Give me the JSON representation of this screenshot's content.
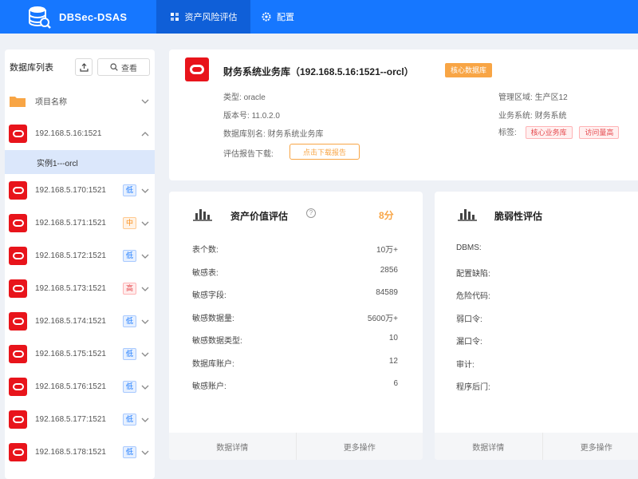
{
  "app": {
    "brand": "DBSec-DSAS"
  },
  "nav": {
    "tabs": [
      {
        "label": "资产风险评估"
      },
      {
        "label": "配置"
      }
    ]
  },
  "sidebar": {
    "title": "数据库列表",
    "search_label": "查看",
    "group": {
      "label": "项目名称"
    },
    "expanded": {
      "label": "192.168.5.16:1521",
      "instance": "实例1---orcl"
    },
    "items": [
      {
        "label": "192.168.5.170:1521",
        "risk": "低",
        "level": "low"
      },
      {
        "label": "192.168.5.171:1521",
        "risk": "中",
        "level": "mid"
      },
      {
        "label": "192.168.5.172:1521",
        "risk": "低",
        "level": "low"
      },
      {
        "label": "192.168.5.173:1521",
        "risk": "高",
        "level": "high"
      },
      {
        "label": "192.168.5.174:1521",
        "risk": "低",
        "level": "low"
      },
      {
        "label": "192.168.5.175:1521",
        "risk": "低",
        "level": "low"
      },
      {
        "label": "192.168.5.176:1521",
        "risk": "低",
        "level": "low"
      },
      {
        "label": "192.168.5.177:1521",
        "risk": "低",
        "level": "low"
      },
      {
        "label": "192.168.5.178:1521",
        "risk": "低",
        "level": "low"
      }
    ]
  },
  "header": {
    "title": "财务系统业务库（192.168.5.16:1521--orcl）",
    "core_tag": "核心数据库",
    "type_label": "类型:",
    "type_value": "oracle",
    "version_label": "版本号:",
    "version_value": "11.0.2.0",
    "alias_label": "数据库别名:",
    "alias_value": "财务系统业务库",
    "report_label": "评估报告下载:",
    "report_button": "点击下载报告",
    "zone_label": "管理区域:",
    "zone_value": "生产区12",
    "biz_label": "业务系统:",
    "biz_value": "财务系统",
    "tags_label": "标签:",
    "tags": [
      "核心业务库",
      "访问量高"
    ]
  },
  "asset_panel": {
    "title": "资产价值评估",
    "score": "8分",
    "metrics": [
      {
        "label": "表个数:",
        "value": "10万+"
      },
      {
        "label": "敏感表:",
        "value": "2856"
      },
      {
        "label": "敏感字段:",
        "value": "84589"
      },
      {
        "label": "敏感数据量:",
        "value": "5600万+"
      },
      {
        "label": "敏感数据类型:",
        "value": "10"
      },
      {
        "label": "数据库账户:",
        "value": "12"
      },
      {
        "label": "敏感账户:",
        "value": "6"
      }
    ],
    "footer": [
      "数据详情",
      "更多操作"
    ]
  },
  "vuln_panel": {
    "title": "脆弱性评估",
    "rows": [
      "DBMS:",
      "配置缺陷:",
      "危险代码:",
      "弱口令:",
      "漏口令:",
      "审计:",
      "程序后门:"
    ],
    "footer": [
      "数据详情",
      "更多操作"
    ]
  }
}
